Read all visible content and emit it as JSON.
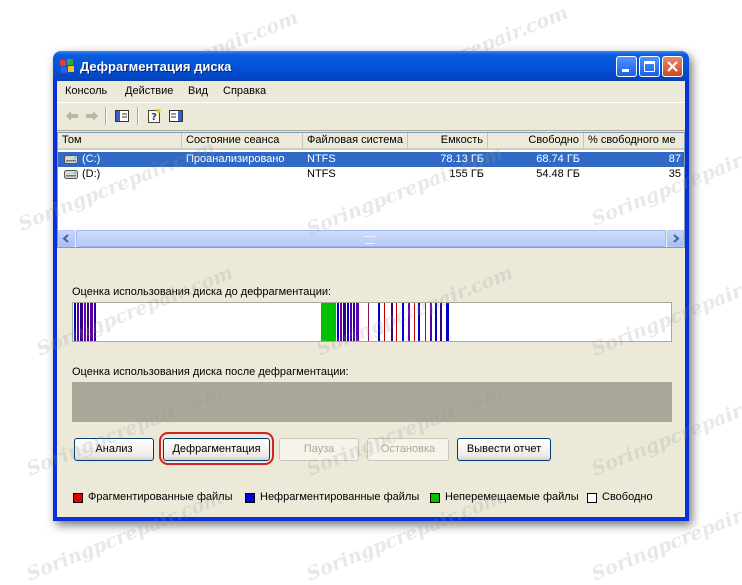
{
  "window": {
    "title": "Дефрагментация диска",
    "controls": {
      "minimize": "minimize",
      "maximize": "maximize",
      "close": "close"
    }
  },
  "menu": [
    "Консоль",
    "Действие",
    "Вид",
    "Справка"
  ],
  "toolbar": {
    "icons": [
      "back-arrow-icon",
      "forward-arrow-icon",
      "show-hide-tree-icon",
      "help-icon",
      "show-action-pane-icon"
    ]
  },
  "table": {
    "columns": [
      "Том",
      "Состояние сеанса",
      "Файловая система",
      "Емкость",
      "Свободно",
      "% свободного ме"
    ],
    "rows": [
      {
        "volume": "(C:)",
        "status": "Проанализировано",
        "fs": "NTFS",
        "capacity": "78.13 ГБ",
        "free": "68.74 ГБ",
        "free_pct": "87",
        "selected": true
      },
      {
        "volume": "(D:)",
        "status": "",
        "fs": "NTFS",
        "capacity": "155 ГБ",
        "free": "54.48 ГБ",
        "free_pct": "35",
        "selected": false
      }
    ]
  },
  "before_label": "Оценка использования диска до дефрагментации:",
  "after_label": "Оценка использования диска после дефрагментации:",
  "buttons": {
    "analyze": "Анализ",
    "defrag": "Дефрагментация",
    "pause": "Пауза",
    "stop": "Остановка",
    "report": "Вывести отчет"
  },
  "legend": [
    {
      "label": "Фрагментированные файлы",
      "color": "#e00000"
    },
    {
      "label": "Нефрагментированные файлы",
      "color": "#0000e0"
    },
    {
      "label": "Неперемещаемые файлы",
      "color": "#00c000"
    },
    {
      "label": "Свободно",
      "color": "#ffffff"
    }
  ],
  "colors": {
    "titlebar": "#0553d9",
    "selection": "#316ac5",
    "fragmented": "#e00000",
    "contiguous": "#0000e0",
    "unmovable": "#00c000",
    "after_fill": "#aba899"
  },
  "watermark": "Soringpcrepair.com"
}
